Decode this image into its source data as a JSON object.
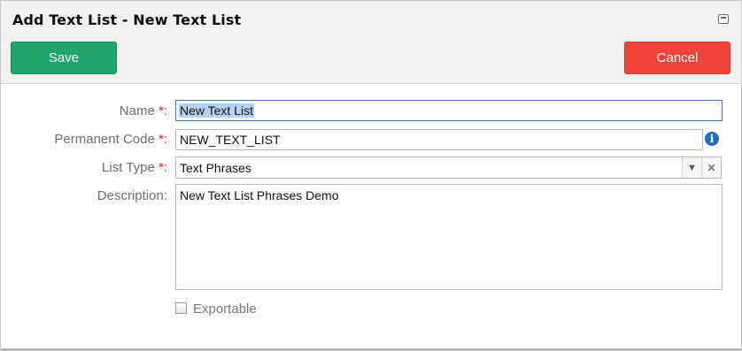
{
  "dialog": {
    "title": "Add Text List - New Text List"
  },
  "buttons": {
    "save_label": "Save",
    "cancel_label": "Cancel"
  },
  "form": {
    "name_label": "Name",
    "name_value": "New Text List",
    "code_label": "Permanent Code",
    "code_value": "NEW_TEXT_LIST",
    "type_label": "List Type",
    "type_value": "Text Phrases",
    "description_label": "Description:",
    "description_value": "New Text List Phrases Demo",
    "exportable_label": "Exportable",
    "exportable_checked": false,
    "required_marker": "*:"
  },
  "colors": {
    "save": "#20a56c",
    "cancel": "#f0433a",
    "info": "#1f6fc0"
  }
}
